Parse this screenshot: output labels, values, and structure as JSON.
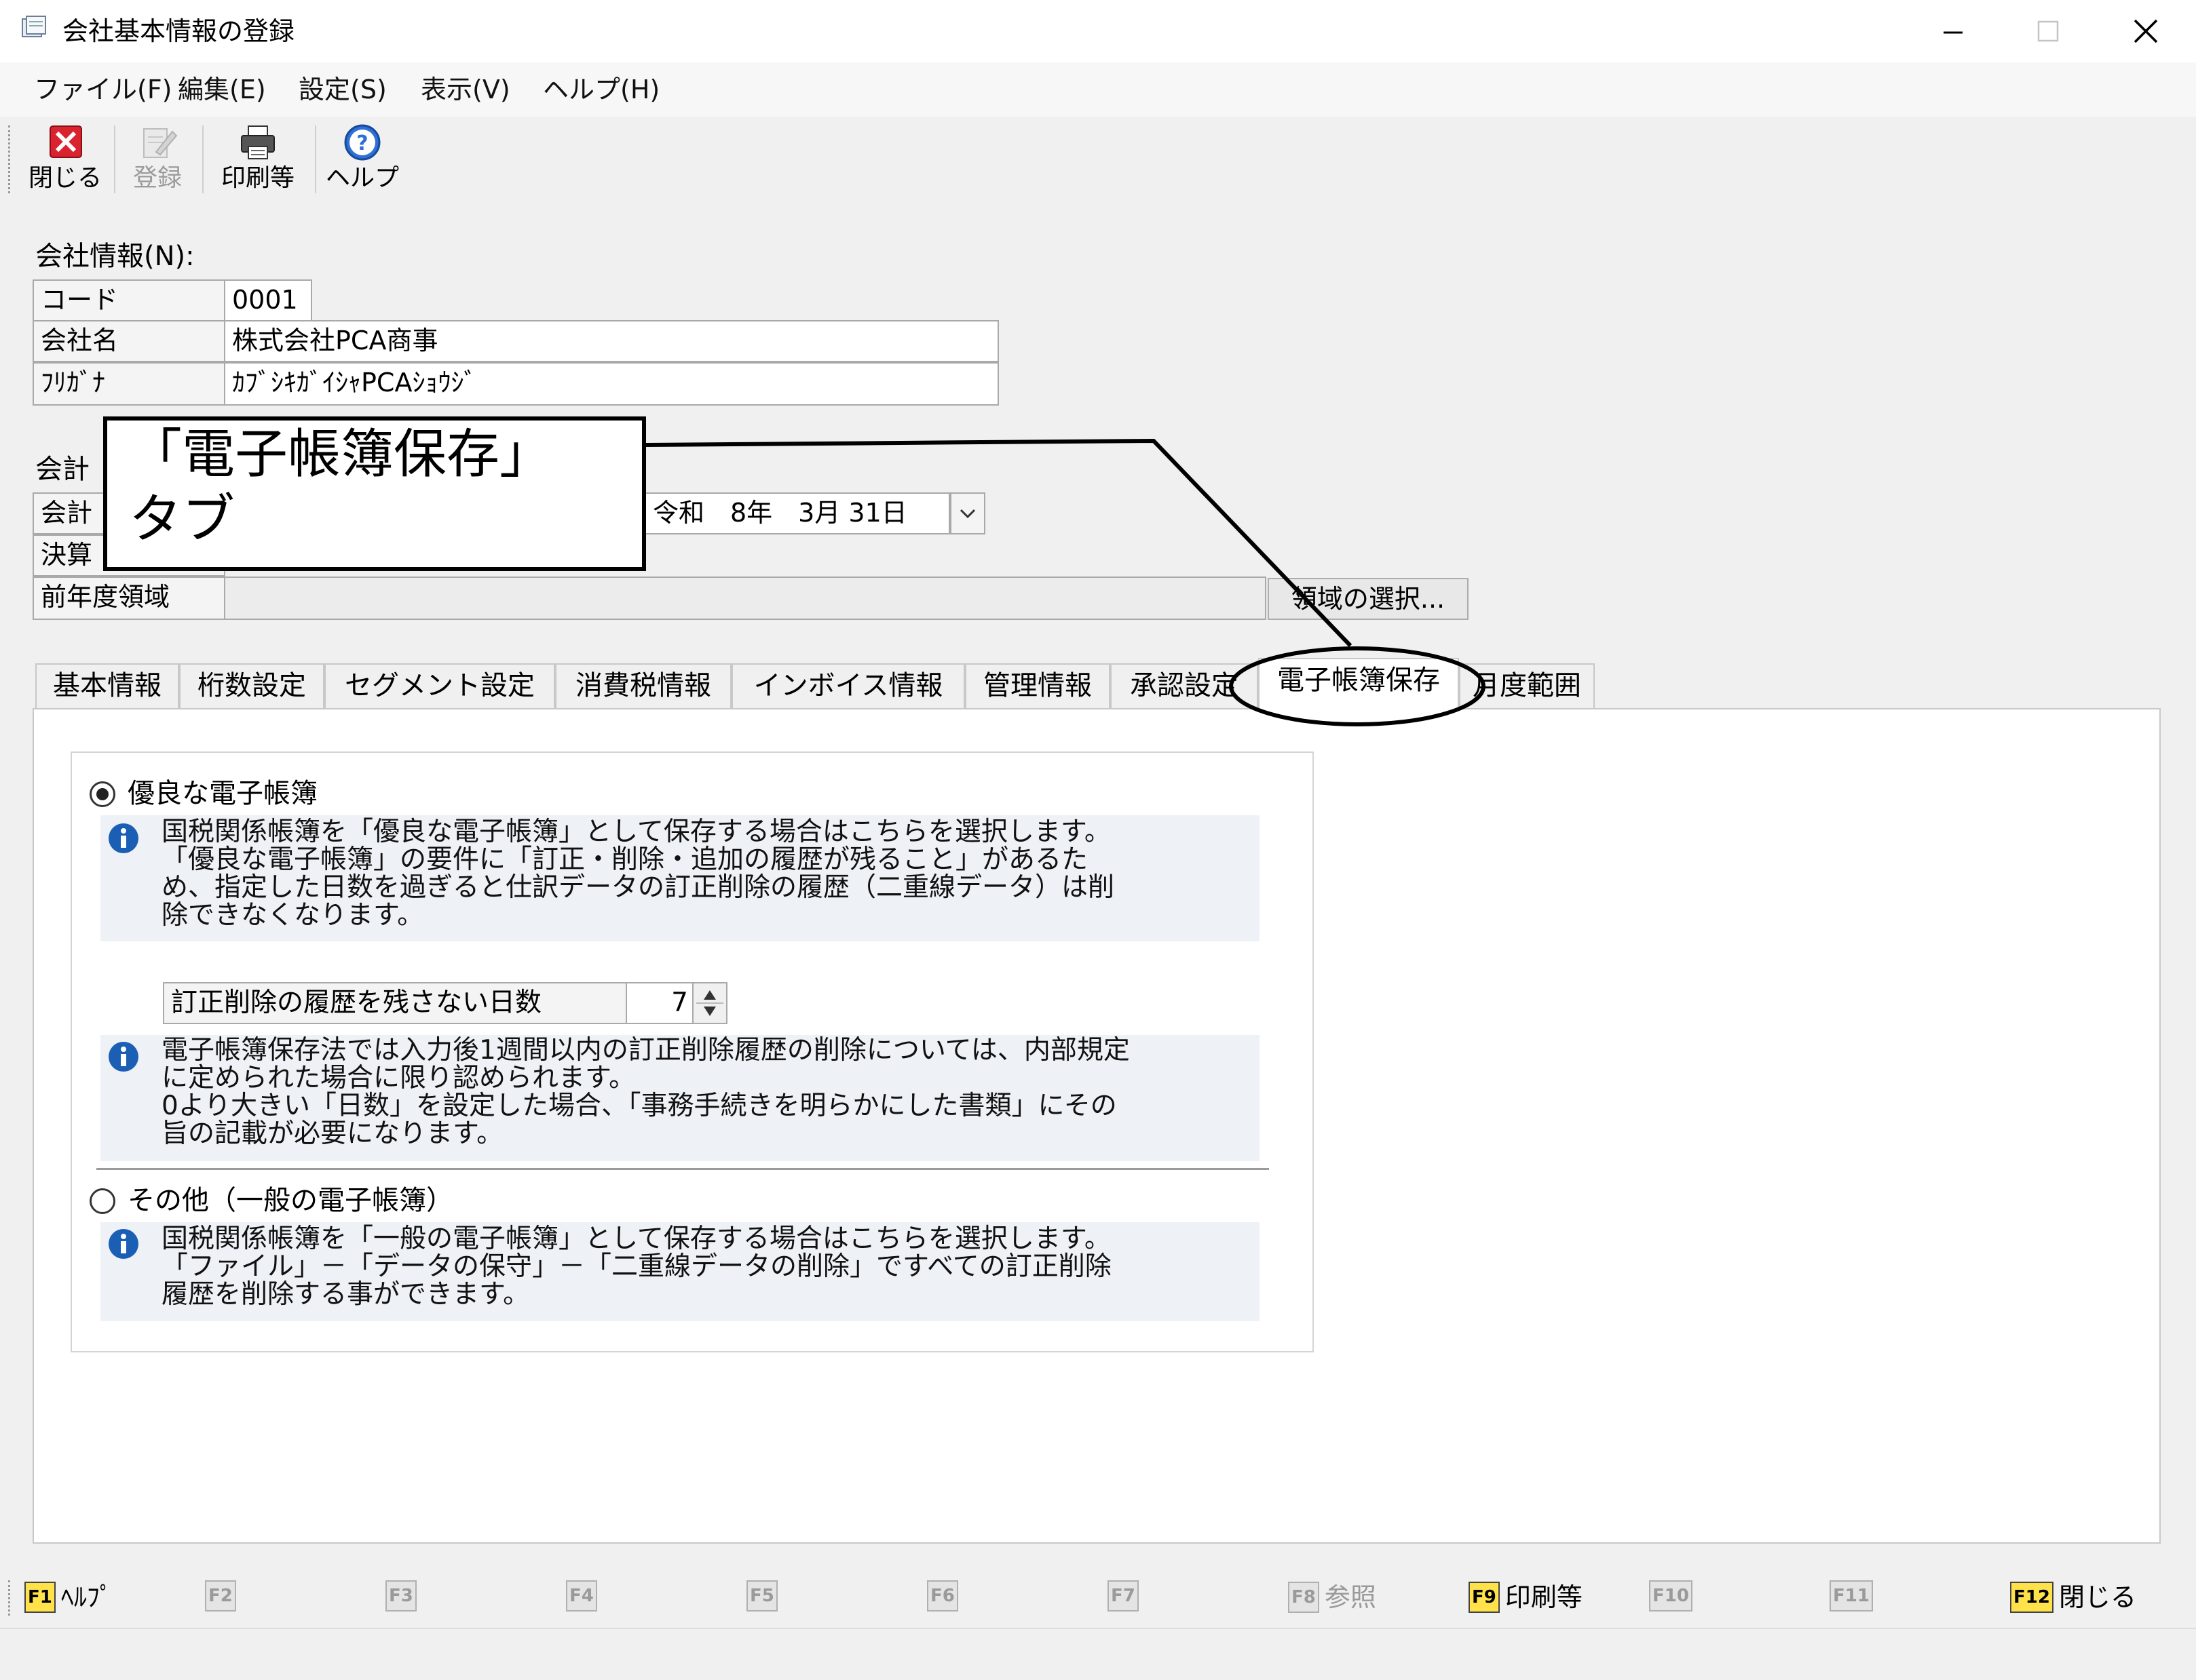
{
  "window": {
    "title": "会社基本情報の登録",
    "controls": [
      "minimize",
      "maximize",
      "close"
    ]
  },
  "menu": [
    {
      "label": "ファイル(F)"
    },
    {
      "label": "編集(E)"
    },
    {
      "label": "設定(S)"
    },
    {
      "label": "表示(V)"
    },
    {
      "label": "ヘルプ(H)"
    }
  ],
  "toolbar": [
    {
      "label": "閉じる",
      "icon": "close-red-icon",
      "enabled": true
    },
    {
      "label": "登録",
      "icon": "register-pen-icon",
      "enabled": false
    },
    {
      "label": "印刷等",
      "icon": "printer-icon",
      "enabled": true
    },
    {
      "label": "ヘルプ",
      "icon": "help-question-icon",
      "enabled": true
    }
  ],
  "company": {
    "section_label": "会社情報(N):",
    "code_label": "コード",
    "code_value": "0001",
    "name_label": "会社名",
    "name_value": "株式会社PCA商事",
    "kana_label": "ﾌﾘｶﾞﾅ",
    "kana_value": "ｶﾌﾞｼｷｶﾞｲｼｬPCAｼｮｳｼﾞ"
  },
  "fiscal": {
    "section_label": "会計",
    "period_label": "会計",
    "period_end": "令和　8年　3月 31日",
    "settlement_label": "決算",
    "prev_label": "前年度領域",
    "prev_value": "",
    "select_button": "領域の選択..."
  },
  "tabs": [
    {
      "label": "基本情報",
      "active": false
    },
    {
      "label": "桁数設定",
      "active": false
    },
    {
      "label": "セグメント設定",
      "active": false
    },
    {
      "label": "消費税情報",
      "active": false
    },
    {
      "label": "インボイス情報",
      "active": false
    },
    {
      "label": "管理情報",
      "active": false
    },
    {
      "label": "承認設定",
      "active": false
    },
    {
      "label": "電子帳簿保存",
      "active": true
    },
    {
      "label": "月度範囲",
      "active": false
    }
  ],
  "panel": {
    "option1": {
      "label": "優良な電子帳簿",
      "selected": true,
      "info": "国税関係帳簿を「優良な電子帳簿」として保存する場合はこちらを選択します。\n「優良な電子帳簿」の要件に「訂正・削除・追加の履歴が残ること」があるた\nめ、指定した日数を過ぎると仕訳データの訂正削除の履歴（二重線データ）は削\n除できなくなります。"
    },
    "days_label": "訂正削除の履歴を残さない日数",
    "days_value": "7",
    "info2": "電子帳簿保存法では入力後1週間以内の訂正削除履歴の削除については、内部規定\nに定められた場合に限り認められます。\n0より大きい「日数」を設定した場合、「事務手続きを明らかにした書類」にその\n旨の記載が必要になります。",
    "option2": {
      "label": "その他（一般の電子帳簿）",
      "selected": false,
      "info": "国税関係帳簿を「一般の電子帳簿」として保存する場合はこちらを選択します。\n「ファイル」－「データの保守」－「二重線データの削除」ですべての訂正削除\n履歴を削除する事ができます。"
    }
  },
  "fkeys": [
    {
      "key": "F1",
      "label": "ﾍﾙﾌﾟ",
      "enabled": true
    },
    {
      "key": "F2",
      "label": "",
      "enabled": false
    },
    {
      "key": "F3",
      "label": "",
      "enabled": false
    },
    {
      "key": "F4",
      "label": "",
      "enabled": false
    },
    {
      "key": "F5",
      "label": "",
      "enabled": false
    },
    {
      "key": "F6",
      "label": "",
      "enabled": false
    },
    {
      "key": "F7",
      "label": "",
      "enabled": false
    },
    {
      "key": "F8",
      "label": "参照",
      "enabled": false
    },
    {
      "key": "F9",
      "label": "印刷等",
      "enabled": true
    },
    {
      "key": "F10",
      "label": "",
      "enabled": false
    },
    {
      "key": "F11",
      "label": "",
      "enabled": false
    },
    {
      "key": "F12",
      "label": "閉じる",
      "enabled": true
    }
  ],
  "callout": {
    "text": "「電子帳簿保存」\nタブ"
  },
  "colors": {
    "accent_yellow": "#ffe24a",
    "close_red": "#d9232e",
    "info_blue": "#1a5fb4",
    "info_bg": "#eef2f7"
  }
}
